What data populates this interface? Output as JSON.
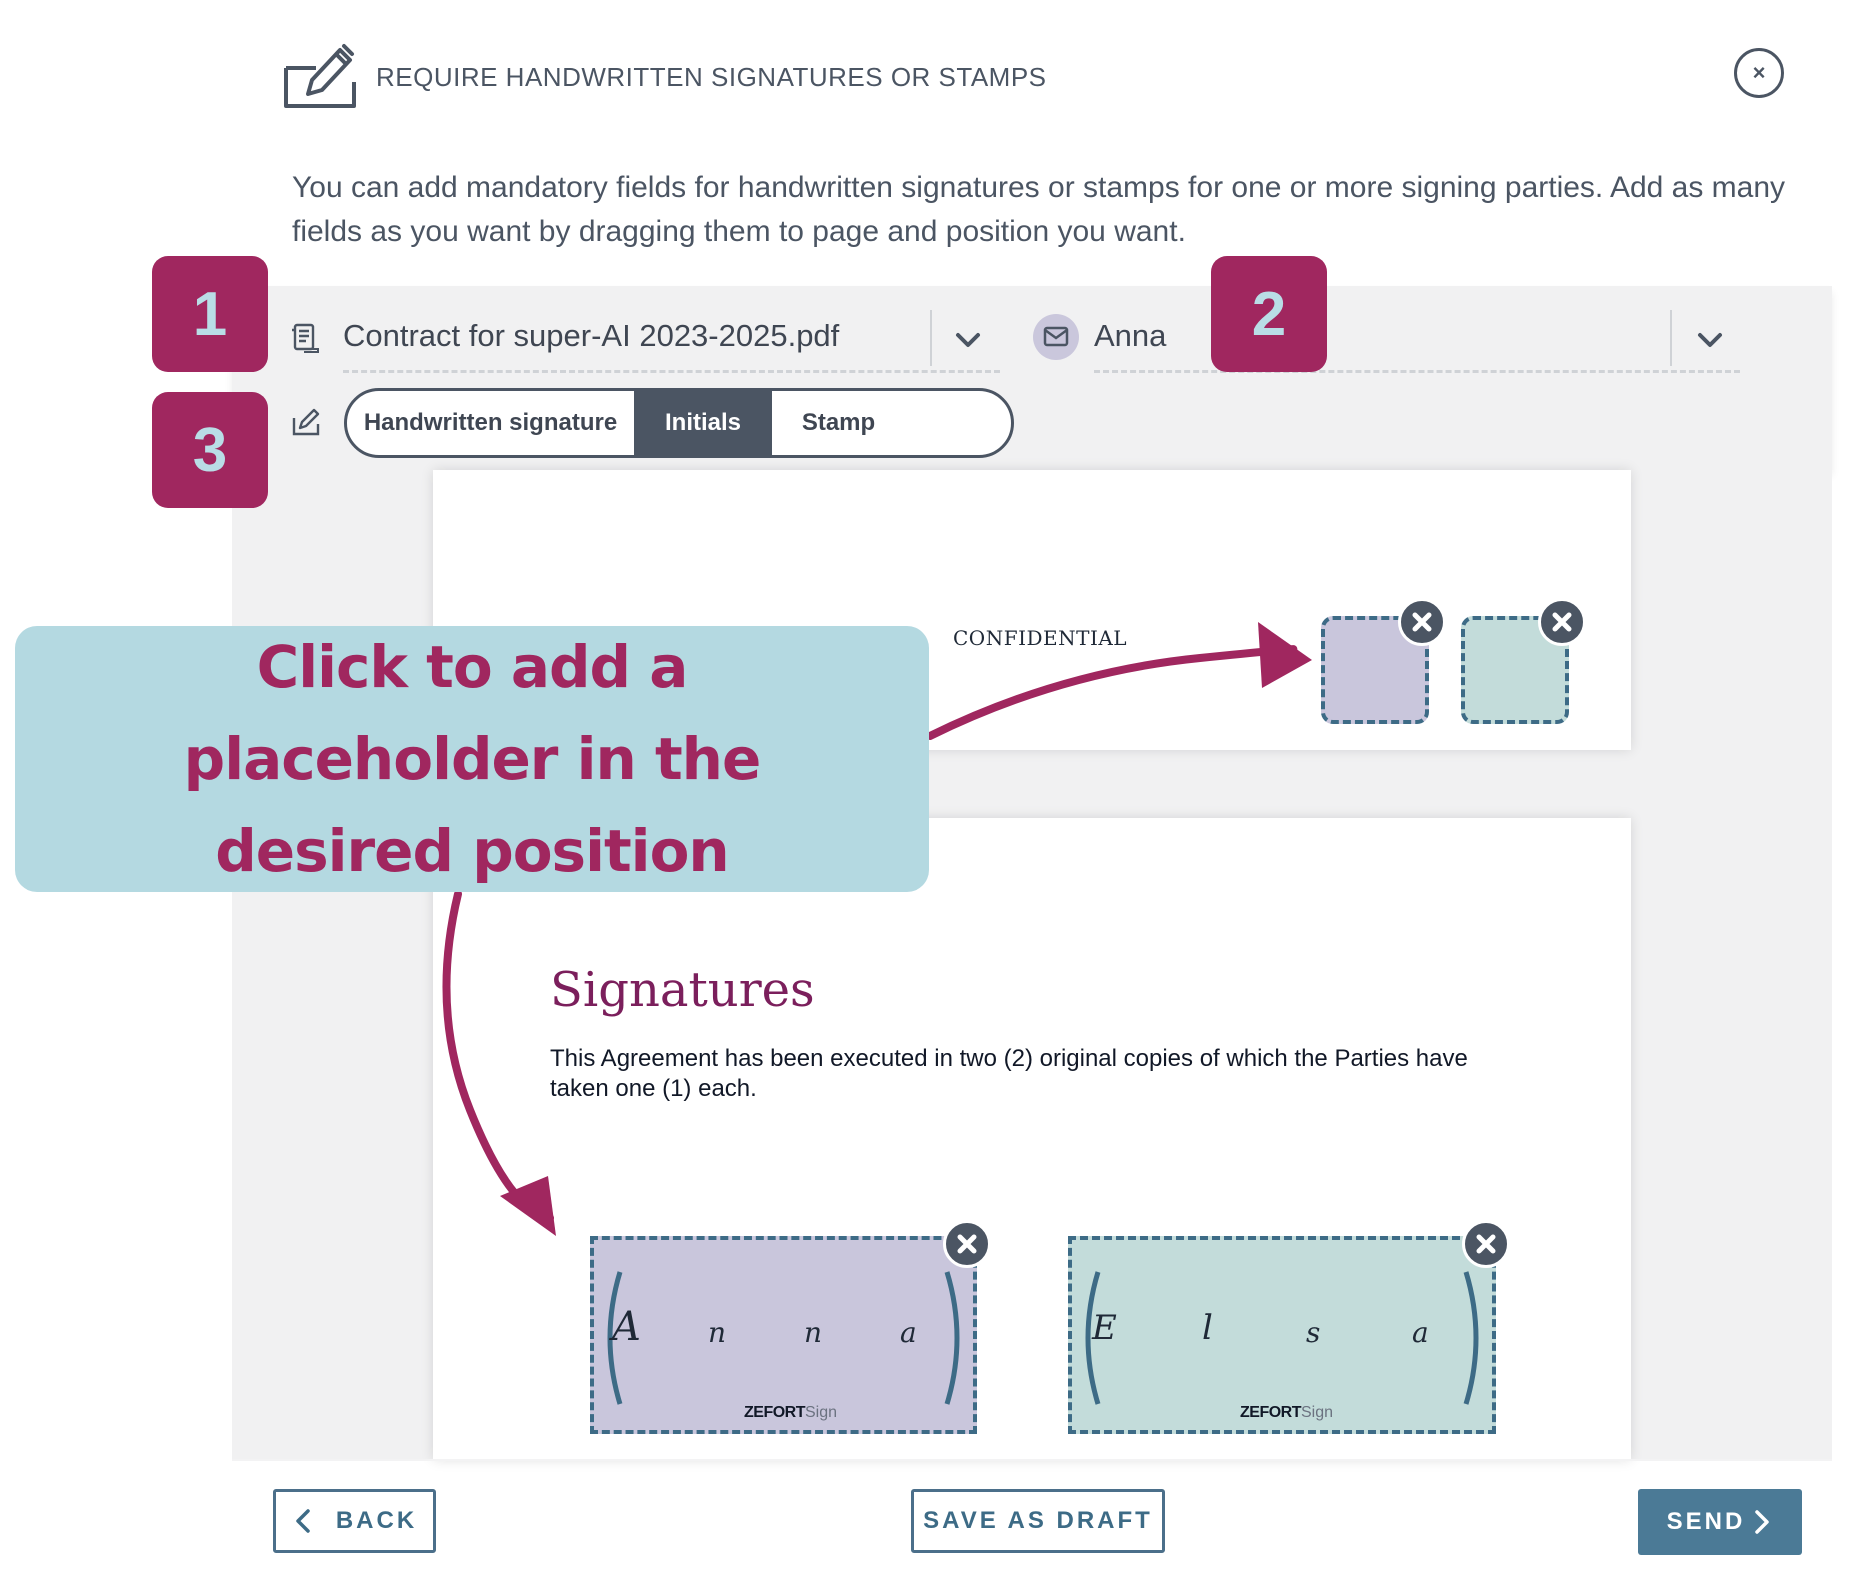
{
  "header": {
    "title": "REQUIRE HANDWRITTEN SIGNATURES OR STAMPS",
    "close_symbol": "×",
    "description": "You can add mandatory fields for handwritten signatures or stamps for one or more signing parties. Add as many fields as you want by dragging them to page and position you want."
  },
  "toolbar": {
    "document_name": "Contract for super-AI 2023-2025.pdf",
    "recipient_name": "Anna",
    "field_types": [
      "Handwritten signature",
      "Initials",
      "Stamp"
    ],
    "active_field_type": "Initials"
  },
  "document": {
    "confidential_label": "CONFIDENTIAL",
    "signatures_heading": "Signatures",
    "signatures_text": "This Agreement has been executed in two (2) original copies of which the Parties have taken one (1) each.",
    "placeholders": [
      {
        "letters": [
          "A",
          "n",
          "n",
          "a"
        ],
        "brand": "ZEFORT",
        "brand_suffix": "Sign",
        "color": "#c9c6dc"
      },
      {
        "letters": [
          "E",
          "l",
          "s",
          "a"
        ],
        "brand": "ZEFORT",
        "brand_suffix": "Sign",
        "color": "#c3dcda"
      }
    ]
  },
  "annotations": {
    "badges": [
      "1",
      "2",
      "3"
    ],
    "callout": "Click to add a placeholder in the desired position",
    "accent_color": "#a0275f",
    "callout_bg": "#b4d9e1"
  },
  "footer": {
    "back_label": "BACK",
    "draft_label": "SAVE AS DRAFT",
    "send_label": "SEND"
  },
  "icons": [
    "signature-pen-icon",
    "close-icon",
    "document-icon",
    "chevron-down-icon",
    "mail-icon",
    "edit-pen-icon",
    "remove-x-icon",
    "chevron-left-icon",
    "chevron-right-icon"
  ]
}
